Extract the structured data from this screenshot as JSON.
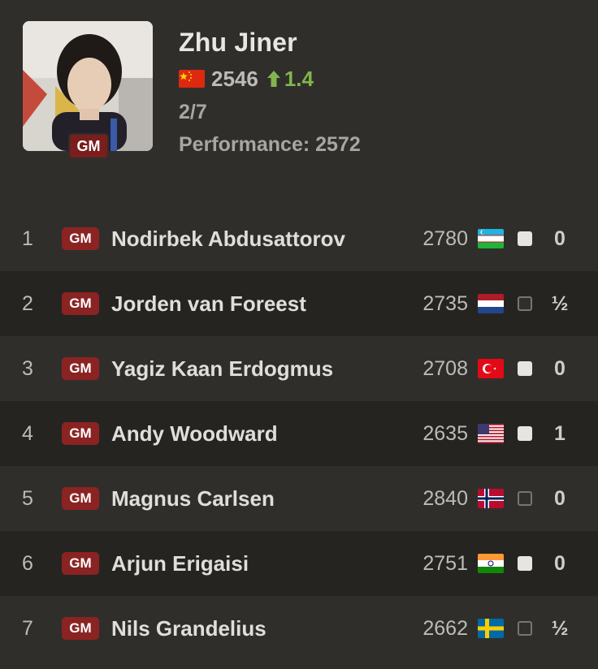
{
  "player": {
    "name": "Zhu Jiner",
    "title": "GM",
    "flag": "china-flag",
    "rating": "2546",
    "rating_change": "1.4",
    "rating_change_icon": "arrow-up-icon",
    "score": "2/7",
    "performance": "Performance: 2572"
  },
  "colors": {
    "background": "#302e2b",
    "alt_row": "#262421",
    "title_badge": "#8b2323",
    "positive": "#81b64c"
  },
  "games": [
    {
      "round": "1",
      "title": "GM",
      "name": "Nodirbek Abdusattorov",
      "rating": "2780",
      "flag": "uzbekistan-flag",
      "piece": "white",
      "result": "0"
    },
    {
      "round": "2",
      "title": "GM",
      "name": "Jorden van Foreest",
      "rating": "2735",
      "flag": "netherlands-flag",
      "piece": "black",
      "result": "½"
    },
    {
      "round": "3",
      "title": "GM",
      "name": "Yagiz Kaan Erdogmus",
      "rating": "2708",
      "flag": "turkey-flag",
      "piece": "white",
      "result": "0"
    },
    {
      "round": "4",
      "title": "GM",
      "name": "Andy Woodward",
      "rating": "2635",
      "flag": "usa-flag",
      "piece": "white",
      "result": "1"
    },
    {
      "round": "5",
      "title": "GM",
      "name": "Magnus Carlsen",
      "rating": "2840",
      "flag": "norway-flag",
      "piece": "black",
      "result": "0"
    },
    {
      "round": "6",
      "title": "GM",
      "name": "Arjun Erigaisi",
      "rating": "2751",
      "flag": "india-flag",
      "piece": "white",
      "result": "0"
    },
    {
      "round": "7",
      "title": "GM",
      "name": "Nils Grandelius",
      "rating": "2662",
      "flag": "sweden-flag",
      "piece": "black",
      "result": "½"
    }
  ]
}
